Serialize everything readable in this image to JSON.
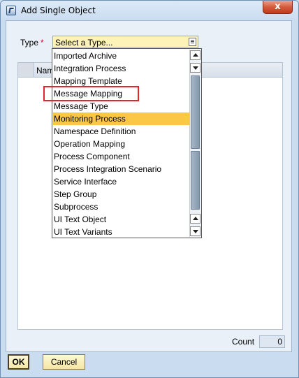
{
  "window": {
    "title": "Add Single Object",
    "close_symbol": "x"
  },
  "form": {
    "type_label": "Type",
    "required_mark": "*",
    "type_value": "Select a Type..."
  },
  "table": {
    "header_name": "Nam"
  },
  "dropdown": {
    "items": [
      "Imported Archive",
      "Integration Process",
      "Mapping Template",
      "Message Mapping",
      "Message Type",
      "Monitoring Process",
      "Namespace Definition",
      "Operation Mapping",
      "Process Component",
      "Process Integration Scenario",
      "Service Interface",
      "Step Group",
      "Subprocess",
      "UI Text Object",
      "UI Text Variants"
    ],
    "selected_item": "Monitoring Process",
    "highlighted_item": "Message Mapping"
  },
  "footer": {
    "count_label": "Count",
    "count_value": "0",
    "ok_label": "OK",
    "cancel_label": "Cancel"
  },
  "colors": {
    "highlight_border": "#e3262b",
    "selected_bg": "#fbc846",
    "field_bg": "#fdf2b8"
  }
}
